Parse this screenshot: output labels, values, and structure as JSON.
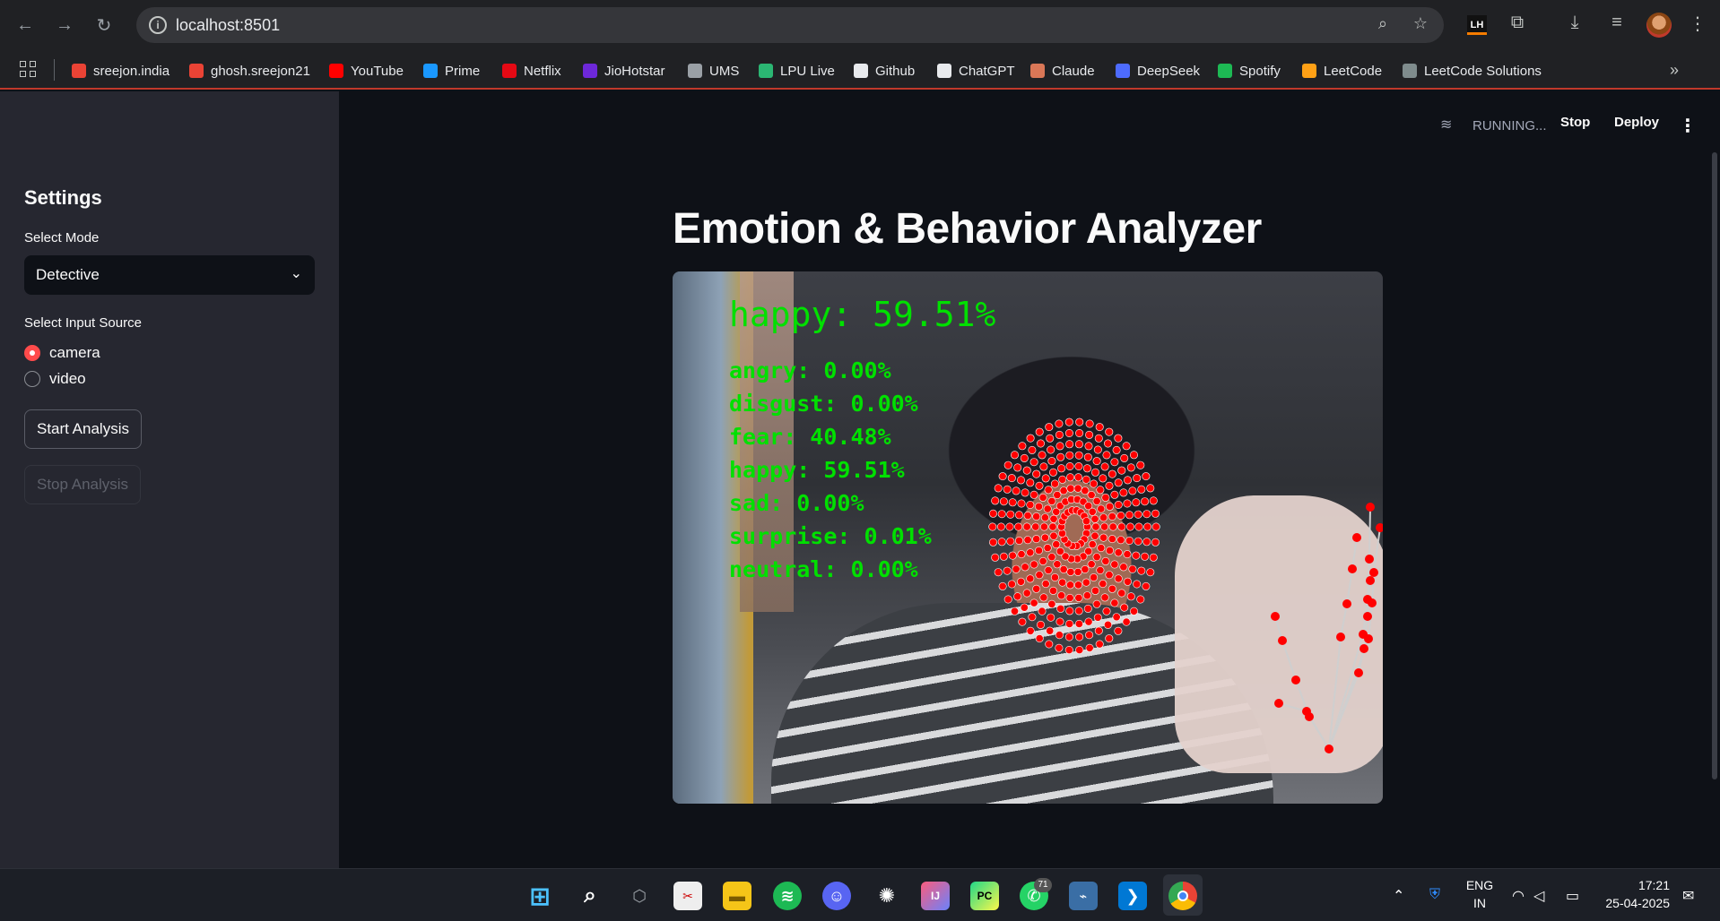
{
  "browser": {
    "url": "localhost:8501",
    "bookmarks": [
      {
        "label": "sreejon.india",
        "icon": "gmail-icon",
        "color": "#ea4335"
      },
      {
        "label": "ghosh.sreejon21",
        "icon": "gmail-icon",
        "color": "#ea4335"
      },
      {
        "label": "YouTube",
        "icon": "youtube-icon",
        "color": "#ff0000"
      },
      {
        "label": "Prime",
        "icon": "prime-icon",
        "color": "#1a98ff"
      },
      {
        "label": "Netflix",
        "icon": "netflix-icon",
        "color": "#e50914"
      },
      {
        "label": "JioHotstar",
        "icon": "jiohotstar-icon",
        "color": "#6d28d9"
      },
      {
        "label": "UMS",
        "icon": "globe-icon",
        "color": "#9aa0a6"
      },
      {
        "label": "LPU Live",
        "icon": "lpu-icon",
        "color": "#2bb673"
      },
      {
        "label": "Github",
        "icon": "github-icon",
        "color": "#e8eaed"
      },
      {
        "label": "ChatGPT",
        "icon": "chatgpt-icon",
        "color": "#e8eaed"
      },
      {
        "label": "Claude",
        "icon": "claude-icon",
        "color": "#d97757"
      },
      {
        "label": "DeepSeek",
        "icon": "deepseek-icon",
        "color": "#4d6bfe"
      },
      {
        "label": "Spotify",
        "icon": "spotify-icon",
        "color": "#1db954"
      },
      {
        "label": "LeetCode",
        "icon": "leetcode-icon",
        "color": "#ffa116"
      },
      {
        "label": "LeetCode Solutions",
        "icon": "leetcode-solutions-icon",
        "color": "#7f8c8d"
      }
    ]
  },
  "app": {
    "status": "RUNNING...",
    "stop_label": "Stop",
    "deploy_label": "Deploy",
    "title": "Emotion & Behavior Analyzer"
  },
  "sidebar": {
    "title": "Settings",
    "mode_label": "Select Mode",
    "mode_value": "Detective",
    "source_label": "Select Input Source",
    "sources": [
      {
        "label": "camera",
        "selected": true
      },
      {
        "label": "video",
        "selected": false
      }
    ],
    "start_label": "Start Analysis",
    "stop_label": "Stop Analysis"
  },
  "video_overlay": {
    "dominant": "happy: 59.51%",
    "emotions": [
      "angry: 0.00%",
      "disgust: 0.00%",
      "fear: 40.48%",
      "happy: 59.51%",
      "sad: 0.00%",
      "surprise: 0.01%",
      "neutral: 0.00%"
    ],
    "overlay_color": "#00e000",
    "landmark_color": "#ff0000"
  },
  "taskbar": {
    "whatsapp_badge": "71",
    "lang_top": "ENG",
    "lang_bottom": "IN",
    "time": "17:21",
    "date": "25-04-2025"
  }
}
